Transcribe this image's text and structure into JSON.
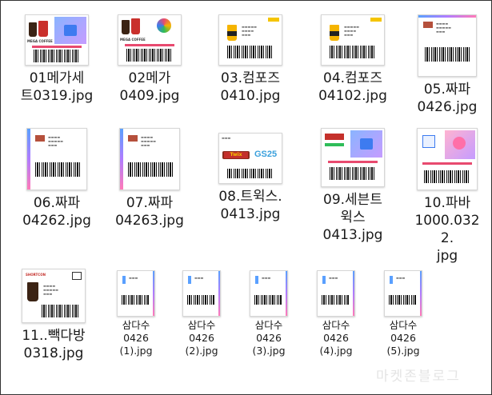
{
  "files": [
    {
      "name": "01메가세트0319.jpg",
      "lines": [
        "01메가세",
        "트0319.jpg"
      ]
    },
    {
      "name": "02메가0409.jpg",
      "lines": [
        "02메가",
        "0409.jpg"
      ]
    },
    {
      "name": "03.컴포즈0410.jpg",
      "lines": [
        "03.컴포즈",
        "0410.jpg"
      ]
    },
    {
      "name": "04.컴포즈04102.jpg",
      "lines": [
        "04.컴포즈",
        "04102.jpg"
      ]
    },
    {
      "name": "05.짜파0426.jpg",
      "lines": [
        "05.짜파",
        "0426.jpg"
      ]
    },
    {
      "name": "06.짜파04262.jpg",
      "lines": [
        "06.짜파",
        "04262.jpg"
      ]
    },
    {
      "name": "07.짜파04263.jpg",
      "lines": [
        "07.짜파",
        "04263.jpg"
      ]
    },
    {
      "name": "08.트윅스.0413.jpg",
      "lines": [
        "08.트윅스.",
        "0413.jpg"
      ]
    },
    {
      "name": "09.세븐트윅스0413.jpg",
      "lines": [
        "09.세븐트",
        "윅스",
        "0413.jpg"
      ]
    },
    {
      "name": "10.파바1000.0322.jpg",
      "lines": [
        "10.파바",
        "1000.0322.",
        "jpg"
      ]
    },
    {
      "name": "11..빽다방0318.jpg",
      "lines": [
        "11..빽다방",
        "0318.jpg"
      ]
    },
    {
      "name": "삼다수0426(1).jpg",
      "lines": [
        "삼다수",
        "0426",
        "(1).jpg"
      ]
    },
    {
      "name": "삼다수0426(2).jpg",
      "lines": [
        "삼다수",
        "0426",
        "(2).jpg"
      ]
    },
    {
      "name": "삼다수0426(3).jpg",
      "lines": [
        "삼다수",
        "0426",
        "(3).jpg"
      ]
    },
    {
      "name": "삼다수0426(4).jpg",
      "lines": [
        "삼다수",
        "0426",
        "(4).jpg"
      ]
    },
    {
      "name": "삼다수0426(5).jpg",
      "lines": [
        "삼다수",
        "0426",
        "(5).jpg"
      ]
    }
  ],
  "thumb_text": {
    "mega_brand": "MEGA COFFEE",
    "gs25": "GS25",
    "twix": "Twix",
    "shortcon": "SHORTCON"
  },
  "watermark": "마켓존블로그",
  "colors": {
    "accent_gradient": [
      "#5aa0ff",
      "#b07cff",
      "#ff7ab8"
    ],
    "frame": "#333333"
  }
}
